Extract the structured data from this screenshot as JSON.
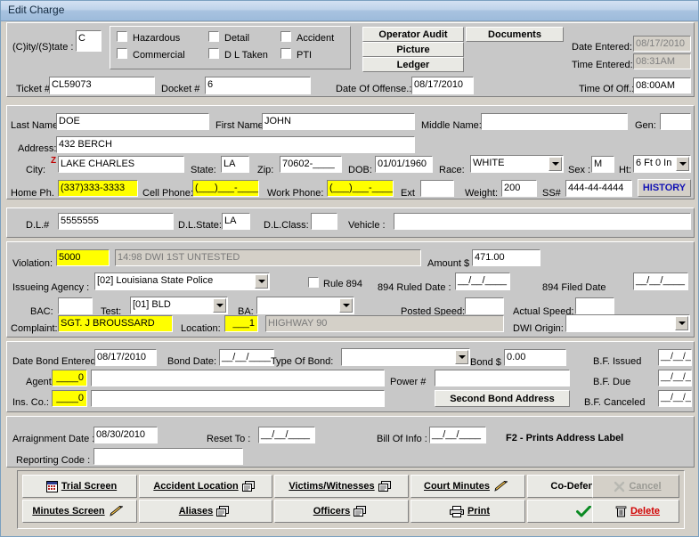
{
  "window": {
    "title": "Edit Charge"
  },
  "header": {
    "citystate_label": "(C)ity/(S)tate :",
    "citystate_value": "C",
    "checkboxes": [
      {
        "label": "Hazardous",
        "checked": false
      },
      {
        "label": "Detail",
        "checked": false
      },
      {
        "label": "Accident",
        "checked": false
      },
      {
        "label": "Commercial",
        "checked": false
      },
      {
        "label": "D L Taken",
        "checked": false
      },
      {
        "label": "PTI",
        "checked": false
      }
    ],
    "buttons": {
      "operator_audit": "Operator Audit",
      "documents": "Documents",
      "picture": "Picture",
      "ledger": "Ledger"
    },
    "date_entered_label": "Date Entered:",
    "date_entered_value": "08/17/2010",
    "time_entered_label": "Time Entered:",
    "time_entered_value": "08:31AM",
    "time_of_off_label": "Time Of Off.:",
    "time_of_off_value": "08:00AM",
    "ticket_label": "Ticket #",
    "ticket_value": "CL59073",
    "docket_label": "Docket #",
    "docket_value": "6",
    "date_of_offense_label": "Date Of Offense.:",
    "date_of_offense_value": "08/17/2010"
  },
  "person": {
    "last_name_label": "Last Name:",
    "last_name_value": "DOE",
    "first_name_label": "First Name:",
    "first_name_value": "JOHN",
    "middle_name_label": "Middle Name:",
    "middle_name_value": "",
    "gen_label": "Gen:",
    "gen_value": "",
    "address_label": "Address:",
    "address_value": "432 BERCH",
    "city_label": "City:",
    "city_flag": "Z",
    "city_value": "LAKE CHARLES",
    "state_label": "State:",
    "state_value": "LA",
    "zip_label": "Zip:",
    "zip_value": "70602-____",
    "dob_label": "DOB:",
    "dob_value": "01/01/1960",
    "race_label": "Race:",
    "race_value": "WHITE",
    "sex_label": "Sex :",
    "sex_value": "M",
    "ht_label": "Ht:",
    "ht_value": "6 Ft 0 In",
    "home_phone_label": "Home Ph. :",
    "home_phone_value": "(337)333-3333",
    "cell_phone_label": "Cell Phone:",
    "cell_phone_value": "(___)___-____",
    "work_phone_label": "Work Phone:",
    "work_phone_value": "(___)___-____",
    "ext_label": "Ext",
    "ext_value": "",
    "weight_label": "Weight:",
    "weight_value": "200",
    "ssn_label": "SS#",
    "ssn_value": "444-44-4444",
    "history_button": "HISTORY"
  },
  "license": {
    "dl_label": "D.L.#",
    "dl_value": "5555555",
    "dl_state_label": "D.L.State:",
    "dl_state_value": "LA",
    "dl_class_label": "D.L.Class:",
    "dl_class_value": "",
    "vehicle_label": "Vehicle :",
    "vehicle_value": ""
  },
  "violation": {
    "violation_label": "Violation:",
    "violation_code": "5000",
    "violation_desc": "14:98 DWI 1ST UNTESTED",
    "amount_label": "Amount $",
    "amount_value": "471.00",
    "agency_label": "Issueing Agency :",
    "agency_value": "[02] Louisiana State Police",
    "rule894_label": "Rule 894",
    "rule894_checked": false,
    "ruled_date_label": "894 Ruled Date :",
    "ruled_date_value": "__/__/____",
    "filed_date_label": "894 Filed Date",
    "filed_date_value": "__/__/____",
    "bac_label": "BAC:",
    "bac_value": "",
    "test_label": "Test:",
    "test_value": "[01] BLD",
    "ba_label": "BA:",
    "ba_value": "",
    "posted_speed_label": "Posted Speed:",
    "posted_speed_value": "",
    "actual_speed_label": "Actual Speed:",
    "actual_speed_value": "",
    "complaint_label": "Complaint:",
    "complaint_value": "SGT. J BROUSSARD",
    "location_label": "Location:",
    "location_code": "___1",
    "location_desc": "HIGHWAY 90",
    "dwi_origin_label": "DWI Origin:",
    "dwi_origin_value": ""
  },
  "bond": {
    "date_bond_entered_label": "Date Bond Entered:",
    "date_bond_entered_value": "08/17/2010",
    "bond_date_label": "Bond Date:",
    "bond_date_value": "__/__/____",
    "type_of_bond_label": "Type Of Bond:",
    "type_of_bond_value": "",
    "bond_amount_label": "Bond $",
    "bond_amount_value": "0.00",
    "bf_issued_label": "B.F. Issued",
    "bf_issued_value": "__/__/____",
    "agent_label": "Agent",
    "agent_code": "____0",
    "agent_name": "",
    "power_label": "Power #",
    "power_value": "",
    "bf_due_label": "B.F. Due",
    "bf_due_value": "__/__/____",
    "ins_co_label": "Ins. Co.:",
    "ins_co_code": "____0",
    "ins_co_name": "",
    "second_bond_address_button": "Second Bond Address",
    "bf_canceled_label": "B.F. Canceled",
    "bf_canceled_value": "__/__/____"
  },
  "arraignment": {
    "arraignment_date_label": "Arraignment Date :",
    "arraignment_date_value": "08/30/2010",
    "reset_to_label": "Reset To :",
    "reset_to_value": "__/__/____",
    "bill_of_info_label": "Bill Of Info :",
    "bill_of_info_value": "__/__/____",
    "f2_hint": "F2 - Prints Address Label",
    "reporting_code_label": "Reporting Code :",
    "reporting_code_value": ""
  },
  "actions": {
    "trial_screen": "Trial Screen",
    "accident_location": "Accident Location",
    "victims_witnesses": "Victims/Witnesses",
    "court_minutes": "Court Minutes",
    "co_defendants": "Co-Defendents",
    "cancel": "Cancel",
    "minutes_screen": "Minutes Screen",
    "aliases": "Aliases",
    "officers": "Officers",
    "print": "Print",
    "save": "Save",
    "delete": "Delete"
  },
  "colors": {
    "highlight": "#ffff00",
    "face": "#d4d0c8",
    "panel": "#c8c8c8",
    "title_accent": "#9dbbdb",
    "history_text": "#1414b4",
    "delete_text": "#d00000"
  }
}
